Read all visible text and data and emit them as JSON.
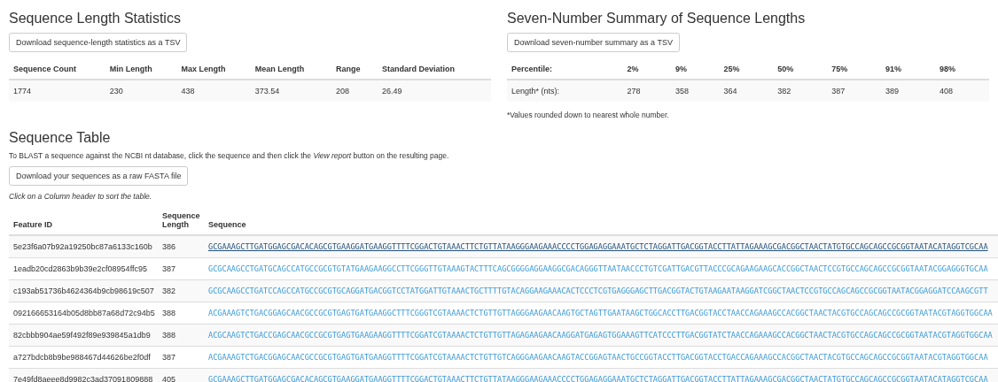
{
  "stats": {
    "title": "Sequence Length Statistics",
    "download_button": "Download sequence-length statistics as a TSV",
    "columns": [
      "Sequence Count",
      "Min Length",
      "Max Length",
      "Mean Length",
      "Range",
      "Standard Deviation"
    ],
    "rows": [
      [
        "1774",
        "230",
        "438",
        "373.54",
        "208",
        "26.49"
      ]
    ]
  },
  "summary": {
    "title": "Seven-Number Summary of Sequence Lengths",
    "download_button": "Download seven-number summary as a TSV",
    "columns": [
      "Percentile:",
      "2%",
      "9%",
      "25%",
      "50%",
      "75%",
      "91%",
      "98%"
    ],
    "rows": [
      [
        "Length* (nts):",
        "278",
        "358",
        "364",
        "382",
        "387",
        "389",
        "408"
      ]
    ],
    "footnote": "*Values rounded down to nearest whole number."
  },
  "sequence_table": {
    "title": "Sequence Table",
    "instructions": "To BLAST a sequence against the NCBI nt database, click the sequence and then click the *View report* button on the resulting page.",
    "download_button": "Download your sequences as a raw FASTA file",
    "sort_hint": "Click on a Column header to sort the table.",
    "columns": [
      "Feature ID",
      "Sequence Length",
      "Sequence"
    ],
    "rows": [
      {
        "feature_id": "5e23f6a07b92a19250bc87a6133c160b",
        "length": "386",
        "sequence": "GCGAAAGCTTGATGGAGCGACACAGCGTGAAGGATGAAGGTTTTCGGACTGTAAACTTCTGTTATAAGGGAAGAAACCCCTGGAGAGGAAATGCTCTAGGATTGACGGTACCTTATTAGAAAGCGACGGCTAACTATGTGCCAGCAGCCGCGGTAATACATAGGTCGCAA",
        "hovered": true
      },
      {
        "feature_id": "1eadb20cd2863b9b39e2cf08954ffc95",
        "length": "387",
        "sequence": "GCGCAAGCCTGATGCAGCCATGCCGCGTGTATGAAGAAGGCCTTCGGGTTGTAAAGTACTTTCAGCGGGGAGGAAGGCGACAGGGTTAATAACCCTGTCGATTGACGTTACCCGCAGAAGAAGCACCGGCTAACTCCGTGCCAGCAGCCGCGGTAATACGGAGGGTGCAA",
        "hovered": false
      },
      {
        "feature_id": "c193ab51736b4624364b9cb98619c507",
        "length": "382",
        "sequence": "GCGCAAGCCTGATCCAGCCATGCCGCGTGCAGGATGACGGTCCTATGGATTGTAAACTGCTTTTGTACAGGAAGAAACACTCCCTCGTGAGGGAGCTTGACGGTACTGTAAGAATAAGGATCGGCTAACTCCGTGCCAGCAGCCGCGGTAATACGGAGGATCCAAGCGTT",
        "hovered": false
      },
      {
        "feature_id": "092166653164b05d8bb87a68d72c94b5",
        "length": "388",
        "sequence": "ACGAAAGTCTGACGGAGCAACGCCGCGTGAGTGATGAAGGCTTTCGGGTCGTAAAACTCTGTTGTTAGGGAAGAACAAGTGCTAGTTGAATAAGCTGGCACCTTGACGGTACCTAACCAGAAAGCCACGGCTAACTACGTGCCAGCAGCCGCGGTAATACGTAGGTGGCAA",
        "hovered": false
      },
      {
        "feature_id": "82cbbb904ae59f492f89e939845a1db9",
        "length": "388",
        "sequence": "ACGCAAGTCTGACCGAGCAACGCCGCGTGAGTGAAGAAGGTTTTCGGATCGTAAAACTCTGTTGTTAGAGAAGAACAAGGATGAGAGTGGAAAGTTCATCCCTTGACGGTATCTAACCAGAAAGCCACGGCTAACTACGTGCCAGCAGCCGCGGTAATACGTAGGTGGCAA",
        "hovered": false
      },
      {
        "feature_id": "a727bdcb8b9be988467d44626be2f0df",
        "length": "387",
        "sequence": "ACGAAAGTCTGACGGAGCAACGCCGCGTGAGTGATGAAGGTTTTCGGATCGTAAAACTCTGTTGTCAGGGAAGAACAAGTACCGGAGTAACTGCCGGTACCTTGACGGTACCTGACCAGAAAGCCACGGCTAACTACGTGCCAGCAGCCGCGGTAATACGTAGGTGGCAA",
        "hovered": false
      },
      {
        "feature_id": "7e49fd8aeee8d9982c3ad37091809888",
        "length": "405",
        "sequence": "GCGAAAGCTTGATGGAGCGACACAGCGTGAAGGATGAAGGTTTTCGGACTGTAAACTTCTGTTATAAGGGAAGAAACCCCTGGAGAGGAAATGCTCTAGGATTGACGGTACCTTATTAGAAAGCGACGGCTAACTATGTGCCAGCAGCCGCGGTAATACATAGGTCGCAA",
        "hovered": false
      }
    ]
  }
}
